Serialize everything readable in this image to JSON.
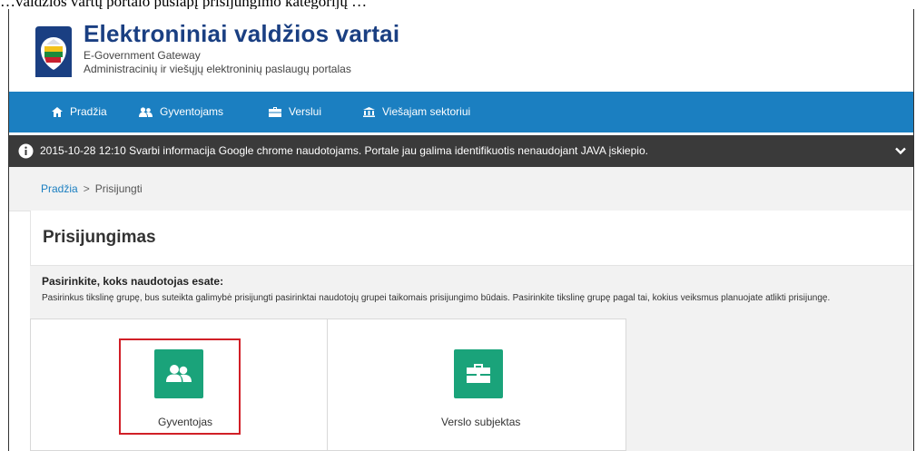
{
  "document": {
    "top_line": "…valdžios vartų portalo puslapį prisijungimo kategorijų …"
  },
  "header": {
    "title": "Elektroniniai valdžios vartai",
    "subtitle": "E-Government Gateway",
    "tagline": "Administracinių ir viešųjų elektroninių paslaugų portalas"
  },
  "nav": {
    "items": [
      {
        "label": "Pradžia",
        "icon": "home-icon"
      },
      {
        "label": "Gyventojams",
        "icon": "people-icon"
      },
      {
        "label": "Verslui",
        "icon": "briefcase-icon"
      },
      {
        "label": "Viešajam sektoriui",
        "icon": "institution-icon"
      }
    ]
  },
  "notice": {
    "text": "2015-10-28 12:10   Svarbi informacija Google chrome naudotojams. Portale jau galima identifikuotis nenaudojant JAVA įskiepio."
  },
  "breadcrumb": {
    "home": "Pradžia",
    "separator": ">",
    "current": "Prisijungti"
  },
  "page": {
    "title": "Prisijungimas",
    "question": "Pasirinkite, koks naudotojas esate:",
    "description": "Pasirinkus tikslinę grupę, bus suteikta galimybė prisijungti pasirinktai naudotojų grupei taikomais prisijungimo būdais. Pasirinkite tikslinę grupę pagal tai, kokius veiksmus planuojate atlikti prisijungę."
  },
  "cards": [
    {
      "label": "Gyventojas",
      "icon": "people-icon",
      "highlighted": true
    },
    {
      "label": "Verslo subjektas",
      "icon": "briefcase-icon",
      "highlighted": false
    }
  ],
  "colors": {
    "brand_blue": "#1b7fc1",
    "title_blue": "#1a3f82",
    "notice_bg": "#3a3a3a",
    "card_icon_green": "#1aa37a",
    "highlight_red": "#d11f27"
  }
}
